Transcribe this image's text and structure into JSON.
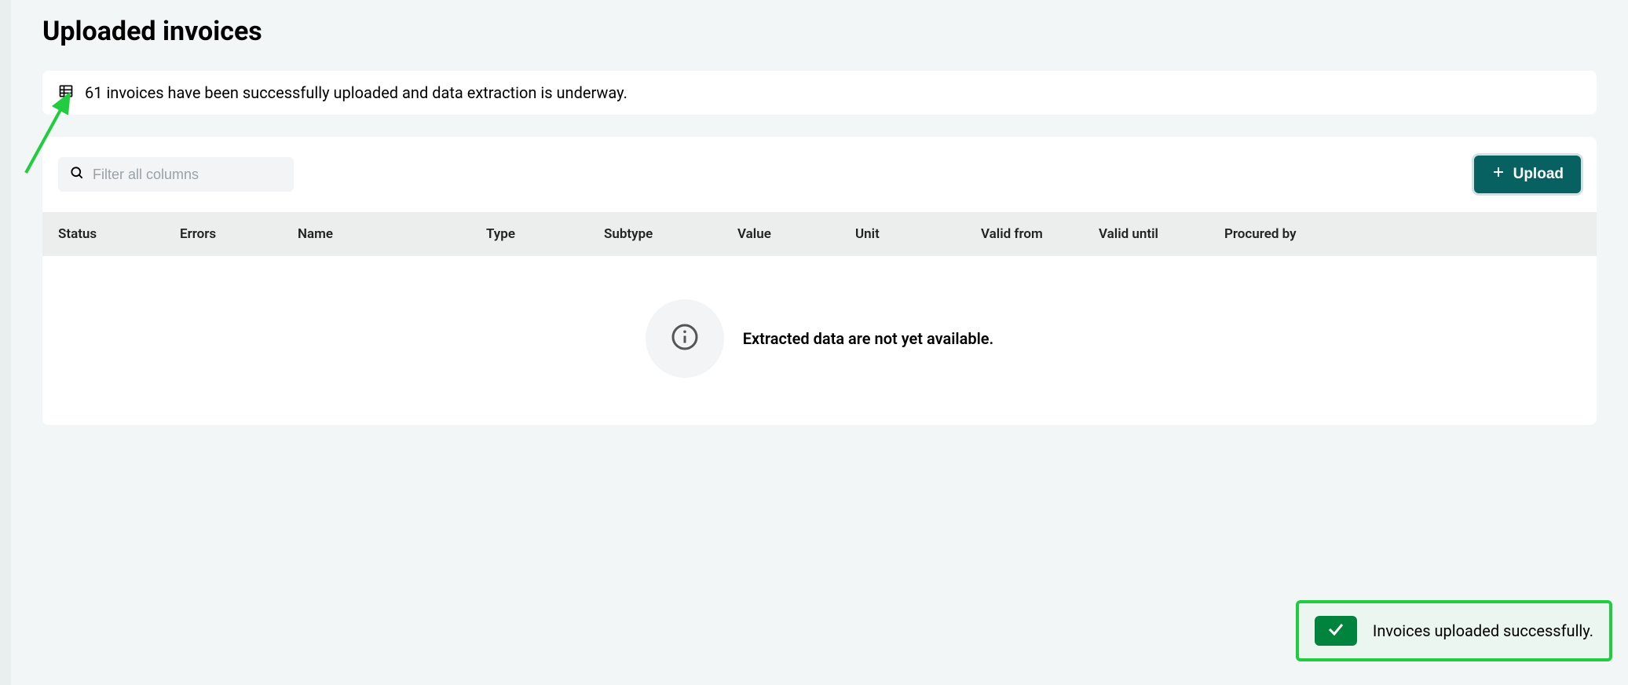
{
  "page": {
    "title": "Uploaded invoices"
  },
  "status": {
    "message": "61 invoices have been successfully uploaded and data extraction is underway."
  },
  "filter": {
    "placeholder": "Filter all columns"
  },
  "buttons": {
    "upload": "Upload"
  },
  "table": {
    "columns": {
      "status": "Status",
      "errors": "Errors",
      "name": "Name",
      "type": "Type",
      "subtype": "Subtype",
      "value": "Value",
      "unit": "Unit",
      "valid_from": "Valid from",
      "valid_until": "Valid until",
      "procured_by": "Procured by"
    },
    "empty_message": "Extracted data are not yet available."
  },
  "toast": {
    "message": "Invoices uploaded successfully."
  }
}
